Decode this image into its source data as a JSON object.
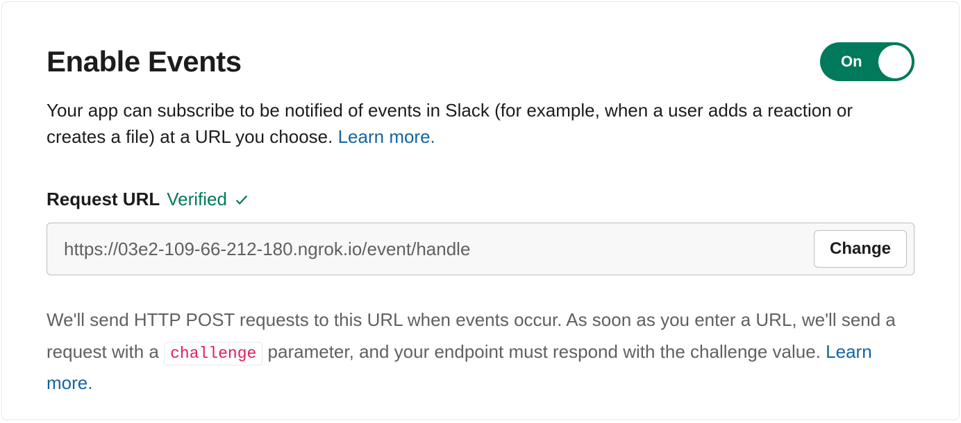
{
  "header": {
    "title": "Enable Events",
    "toggle_label": "On",
    "toggle_state": "on"
  },
  "description": {
    "text_before_link": "Your app can subscribe to be notified of events in Slack (for example, when a user adds a reaction or creates a file) at a URL you choose. ",
    "link_text": "Learn more."
  },
  "request_url": {
    "label": "Request URL",
    "status": "Verified",
    "value": "https://03e2-109-66-212-180.ngrok.io/event/handle",
    "change_button": "Change"
  },
  "footer": {
    "text_before_code": "We'll send HTTP POST requests to this URL when events occur. As soon as you enter a URL, we'll send a request with a ",
    "code": "challenge",
    "text_after_code": " parameter, and your endpoint must respond with the challenge value. ",
    "link_text": "Learn more."
  }
}
